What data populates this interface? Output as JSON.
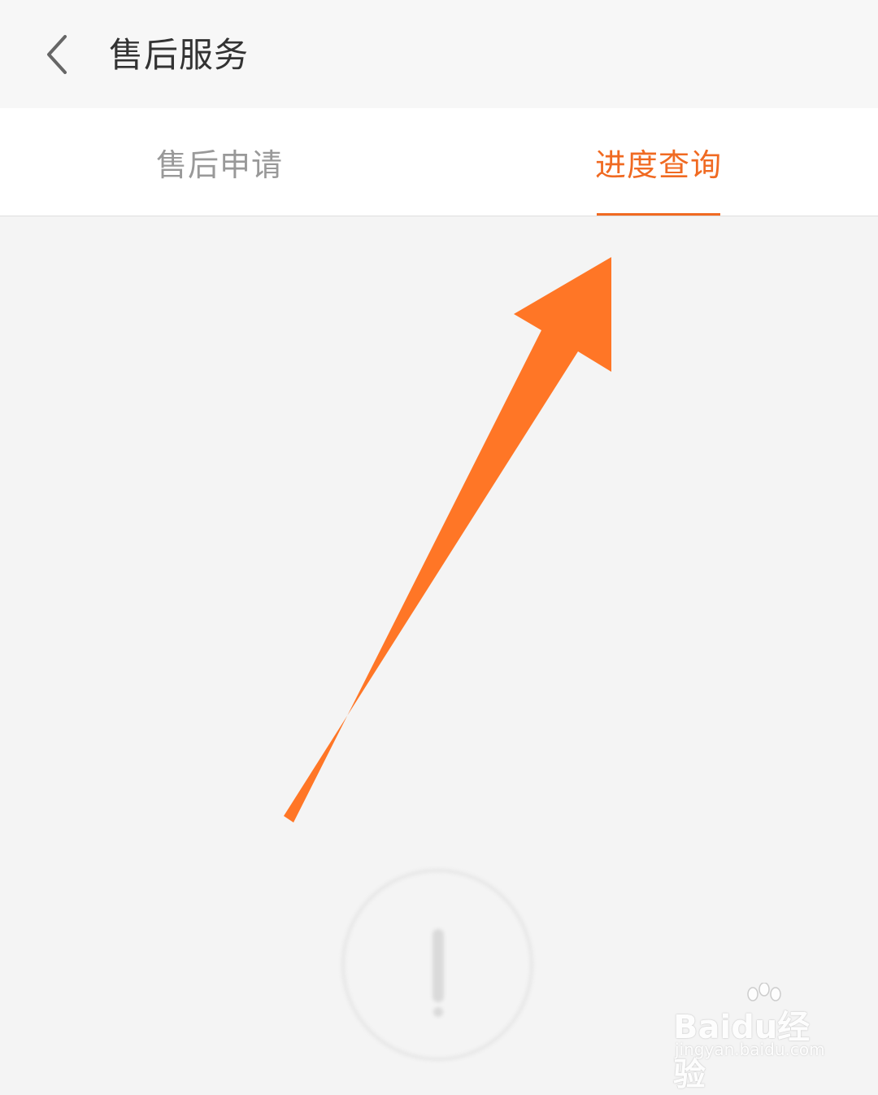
{
  "header": {
    "title": "售后服务",
    "back_icon": "chevron-left-icon"
  },
  "tabs": [
    {
      "label": "售后申请",
      "active": false
    },
    {
      "label": "进度查询",
      "active": true
    }
  ],
  "colors": {
    "accent": "#f06a22",
    "annotation_arrow": "#ff7626",
    "inactive_tab": "#999999",
    "background": "#f4f4f4"
  },
  "empty_state": {
    "icon": "exclamation-circle-icon"
  },
  "watermark": {
    "brand": "Baidu经验",
    "url": "jingyan.baidu.com"
  }
}
